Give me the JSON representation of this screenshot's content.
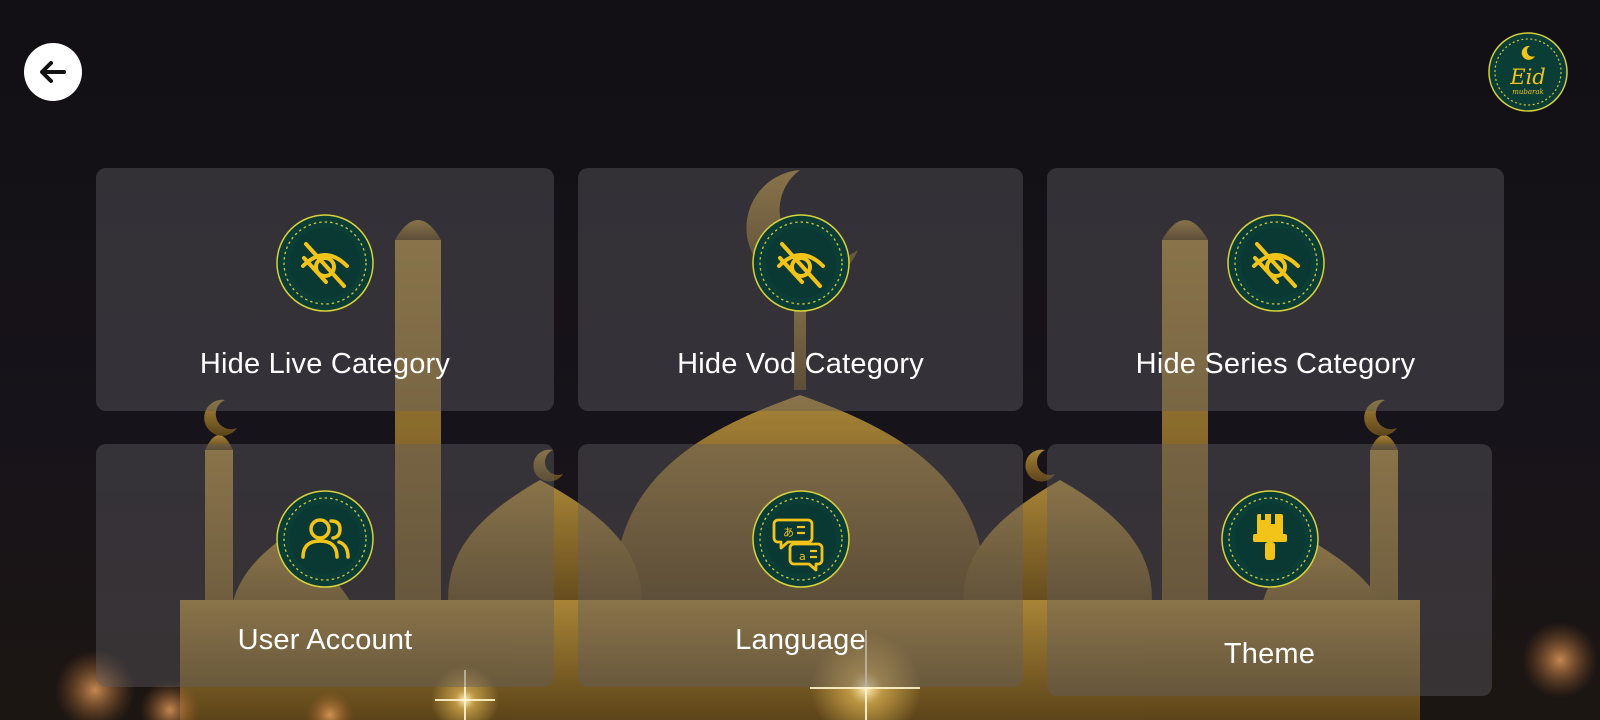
{
  "header": {
    "back_icon": "arrow-left-icon",
    "logo_text": "Eid",
    "logo_subtext": "mubarak"
  },
  "menu": [
    {
      "id": "hide-live",
      "label": "Hide Live Category",
      "icon": "eye-off-icon"
    },
    {
      "id": "hide-vod",
      "label": "Hide Vod Category",
      "icon": "eye-off-icon"
    },
    {
      "id": "hide-series",
      "label": "Hide Series Category",
      "icon": "eye-off-icon"
    },
    {
      "id": "user-account",
      "label": "User Account",
      "icon": "users-icon"
    },
    {
      "id": "language",
      "label": "Language",
      "icon": "translate-icon"
    },
    {
      "id": "theme",
      "label": "Theme",
      "icon": "paint-brush-icon"
    }
  ],
  "colors": {
    "medal_bg": "#0b3d37",
    "medal_ring": "#d8d23a",
    "icon_gold": "#f2c419",
    "tile_bg": "rgba(95,93,100,0.42)",
    "page_bg": "#141116",
    "mosque_gold": "#b48a2a"
  }
}
